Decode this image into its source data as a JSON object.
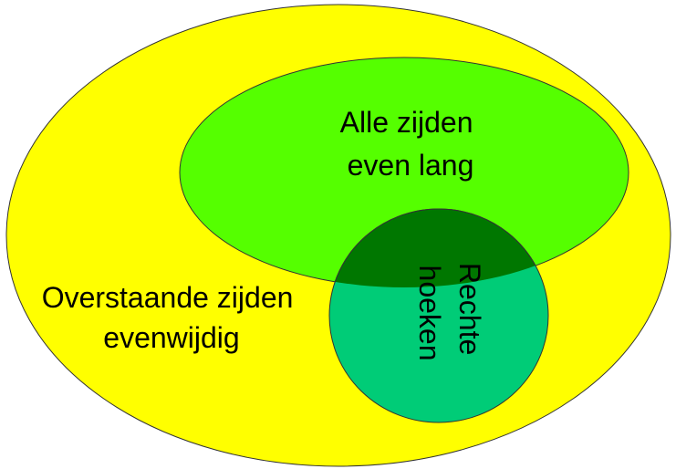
{
  "diagram": {
    "colors": {
      "parallelogram_set": "#ffff00",
      "rhombus_set": "#55ff00",
      "rectangle_set": "#00cc77",
      "square_overlap": "#007700",
      "stroke": "#333333"
    },
    "sets": {
      "parallel": {
        "line1": "Overstaande zijden",
        "line2": "evenwijdig"
      },
      "equal_sides": {
        "line1": "Alle  zijden",
        "line2": "even lang"
      },
      "right_angles": {
        "line1": "Rechte",
        "line2": "hoeken"
      }
    }
  }
}
